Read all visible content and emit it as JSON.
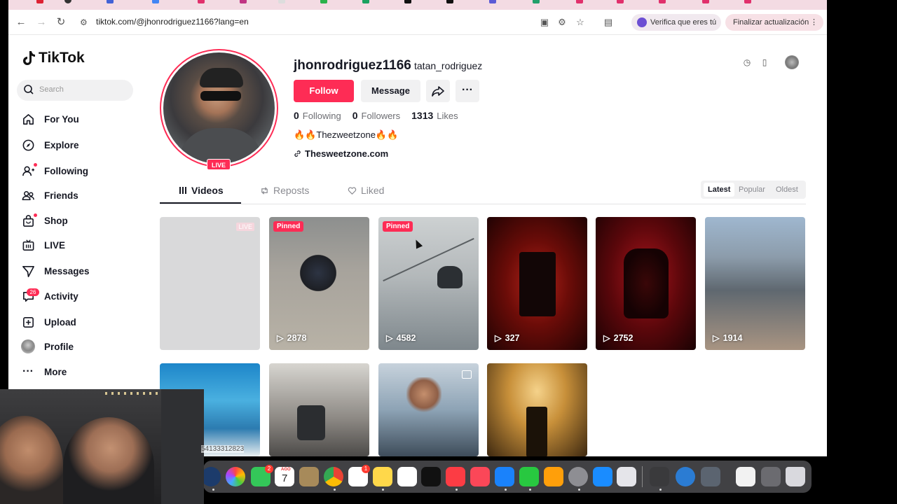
{
  "browser": {
    "url": "tiktok.com/@jhonrodriguez1166?lang=en",
    "verify_label": "Verifica que eres tú",
    "update_label": "Finalizar actualización"
  },
  "sidebar": {
    "logo": "TikTok",
    "search_placeholder": "Search",
    "items": [
      {
        "label": "For You",
        "icon": "home-icon"
      },
      {
        "label": "Explore",
        "icon": "compass-icon"
      },
      {
        "label": "Following",
        "icon": "user-follow-icon"
      },
      {
        "label": "Friends",
        "icon": "friends-icon"
      },
      {
        "label": "Shop",
        "icon": "shop-icon"
      },
      {
        "label": "LIVE",
        "icon": "live-icon"
      },
      {
        "label": "Messages",
        "icon": "messages-icon"
      },
      {
        "label": "Activity",
        "icon": "activity-icon"
      },
      {
        "label": "Upload",
        "icon": "upload-icon"
      },
      {
        "label": "Profile",
        "icon": "profile-avatar"
      },
      {
        "label": "More",
        "icon": "more-icon"
      }
    ],
    "activity_badge": "26"
  },
  "profile": {
    "username": "jhonrodriguez1166",
    "nickname": "tatan_rodriguez",
    "live_tag": "LIVE",
    "follow_label": "Follow",
    "message_label": "Message",
    "more_label": "···",
    "following_count": "0",
    "following_label": "Following",
    "followers_count": "0",
    "followers_label": "Followers",
    "likes_count": "1313",
    "likes_label": "Likes",
    "bio": "🔥🔥Thezweetzone🔥🔥",
    "link": "Thesweetzone.com"
  },
  "tabs": {
    "videos": "Videos",
    "reposts": "Reposts",
    "liked": "Liked"
  },
  "sort": {
    "latest": "Latest",
    "popular": "Popular",
    "oldest": "Oldest"
  },
  "videos": [
    {
      "views": "",
      "badge": "LIVE"
    },
    {
      "views": "2878",
      "badge": "Pinned"
    },
    {
      "views": "4582",
      "badge": "Pinned"
    },
    {
      "views": "327",
      "badge": ""
    },
    {
      "views": "2752",
      "badge": ""
    },
    {
      "views": "1914",
      "badge": ""
    },
    {
      "views": "",
      "badge": ""
    },
    {
      "views": "",
      "badge": ""
    },
    {
      "views": "",
      "badge": ""
    },
    {
      "views": "",
      "badge": ""
    }
  ],
  "webcam_caption": "54133312823",
  "dock": {
    "calendar_month": "AGO",
    "calendar_day": "7",
    "facetime_badge": "2",
    "reminders_badge": "1"
  },
  "colors": {
    "accent": "#fe2c55",
    "text": "#161823"
  }
}
